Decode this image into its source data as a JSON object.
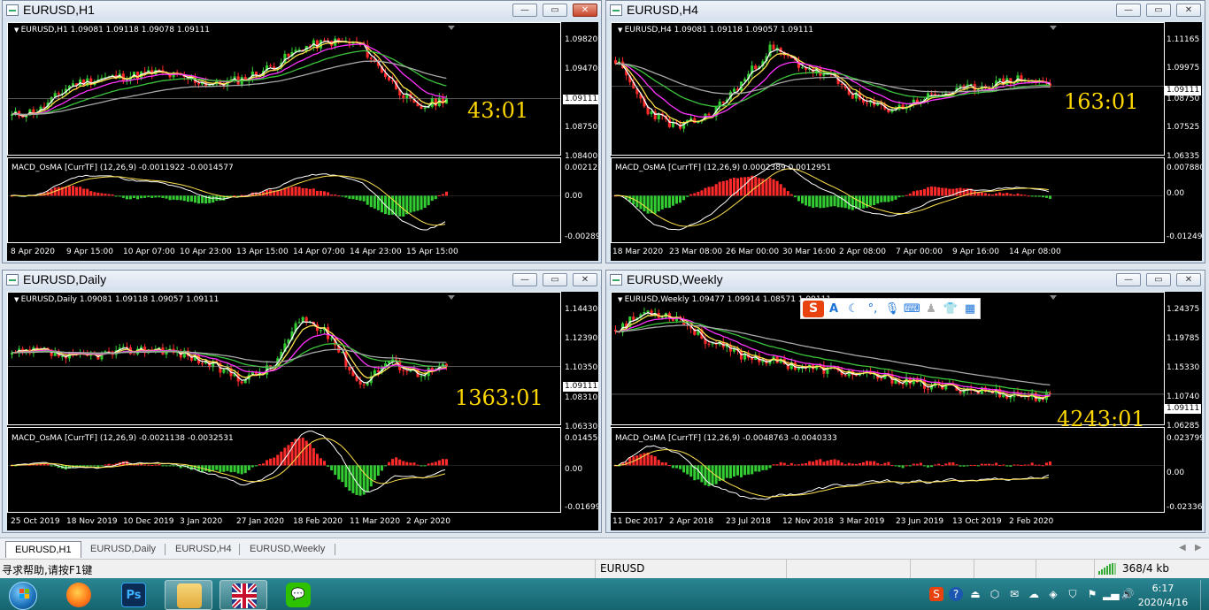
{
  "windows": [
    {
      "id": "h1",
      "title": "EURUSD,H1",
      "symbol_line": "EURUSD,H1  1.09081 1.09118 1.09078 1.09111",
      "osma_line": "MACD_OsMA [CurrTF] (12,26,9) -0.0011922 -0.0014577",
      "timer": "43:01",
      "price_axis": [
        "1.09820",
        "1.09470",
        "1.08750",
        "1.08400"
      ],
      "current_price": "1.09111",
      "osma_axis": [
        "0.0021275",
        "0.00",
        "-0.002893"
      ],
      "time_axis": [
        "8 Apr 2020",
        "9 Apr 15:00",
        "10 Apr 07:00",
        "10 Apr 23:00",
        "13 Apr 15:00",
        "14 Apr 07:00",
        "14 Apr 23:00",
        "15 Apr 15:00"
      ],
      "close_button_highlight": true,
      "seed": 11,
      "trend": [
        0.3,
        0.35,
        0.55,
        0.6,
        0.62,
        0.65,
        0.6,
        0.55,
        0.6,
        0.7,
        0.85,
        0.9,
        0.88,
        0.6,
        0.35,
        0.45
      ]
    },
    {
      "id": "h4",
      "title": "EURUSD,H4",
      "symbol_line": "EURUSD,H4  1.09081 1.09118 1.09057 1.09111",
      "osma_line": "MACD_OsMA [CurrTF] (12,26,9) 0.0002389 0.0012951",
      "timer": "163:01",
      "price_axis": [
        "1.11165",
        "1.09975",
        "1.08750",
        "1.07525",
        "1.06335"
      ],
      "current_price": "1.09111",
      "osma_axis": [
        "0.0078805",
        "0.00",
        "-0.012499"
      ],
      "time_axis": [
        "18 Mar 2020",
        "23 Mar 08:00",
        "26 Mar 00:00",
        "30 Mar 16:00",
        "2 Apr 08:00",
        "7 Apr 00:00",
        "9 Apr 16:00",
        "14 Apr 08:00"
      ],
      "close_button_highlight": false,
      "seed": 23,
      "trend": [
        0.75,
        0.35,
        0.2,
        0.3,
        0.55,
        0.85,
        0.7,
        0.6,
        0.4,
        0.35,
        0.45,
        0.5,
        0.55,
        0.6,
        0.55
      ]
    },
    {
      "id": "daily",
      "title": "EURUSD,Daily",
      "symbol_line": "EURUSD,Daily  1.09081 1.09118 1.09057 1.09111",
      "osma_line": "MACD_OsMA [CurrTF] (12,26,9) -0.0021138 -0.0032531",
      "timer": "1363:01",
      "price_axis": [
        "1.14430",
        "1.12390",
        "1.10350",
        "1.08310",
        "1.06330"
      ],
      "current_price": "1.09111",
      "osma_axis": [
        "0.0145505",
        "0.00",
        "-0.016995"
      ],
      "time_axis": [
        "25 Oct 2019",
        "18 Nov 2019",
        "10 Dec 2019",
        "3 Jan 2020",
        "27 Jan 2020",
        "18 Feb 2020",
        "11 Mar 2020",
        "2 Apr 2020"
      ],
      "close_button_highlight": false,
      "seed": 37,
      "trend": [
        0.55,
        0.58,
        0.52,
        0.55,
        0.58,
        0.6,
        0.55,
        0.45,
        0.35,
        0.45,
        0.85,
        0.7,
        0.3,
        0.5,
        0.4,
        0.45
      ]
    },
    {
      "id": "weekly",
      "title": "EURUSD,Weekly",
      "symbol_line": "EURUSD,Weekly  1.09477 1.09914 1.08571 1.09111",
      "osma_line": "MACD_OsMA [CurrTF] (12,26,9) -0.0048763 -0.0040333",
      "timer": "4243:01",
      "price_axis": [
        "1.24375",
        "1.19785",
        "1.15330",
        "1.10740",
        "1.06285"
      ],
      "current_price": "1.09111",
      "osma_axis": [
        "0.0237996",
        "0.00",
        "-0.023368"
      ],
      "time_axis": [
        "11 Dec 2017",
        "2 Apr 2018",
        "23 Jul 2018",
        "12 Nov 2018",
        "3 Mar 2019",
        "23 Jun 2019",
        "13 Oct 2019",
        "2 Feb 2020"
      ],
      "close_button_highlight": false,
      "seed": 53,
      "trend": [
        0.75,
        0.9,
        0.85,
        0.65,
        0.55,
        0.5,
        0.45,
        0.42,
        0.38,
        0.35,
        0.3,
        0.28,
        0.25,
        0.22,
        0.2
      ]
    }
  ],
  "ime_toolbar": {
    "logo": "S",
    "icons": [
      "letter-a-icon",
      "moon-icon",
      "punctuation-icon",
      "microphone-icon",
      "keyboard-icon",
      "user-icon",
      "shirt-icon",
      "grid-icon"
    ]
  },
  "tabs": [
    "EURUSD,H1",
    "EURUSD,Daily",
    "EURUSD,H4",
    "EURUSD,Weekly"
  ],
  "active_tab": "EURUSD,H1",
  "status": {
    "help": "寻求帮助,请按F1键",
    "profile": "EURUSD",
    "traffic": "368/4 kb"
  },
  "taskbar": {
    "apps": [
      "firefox",
      "photoshop",
      "file-explorer",
      "metatrader",
      "wechat"
    ],
    "ps_label": "Ps",
    "time": "6:17",
    "date": "2020/4/16"
  },
  "colors": {
    "bull": "#33cc33",
    "bear": "#ff2a2a",
    "ma_white": "#ffffff",
    "ma_yellow": "#ffe14d",
    "ma_magenta": "#ff33ff",
    "ma_green": "#3cc43c",
    "ma_gray": "#a8a8a8",
    "timer": "#ffd700"
  }
}
